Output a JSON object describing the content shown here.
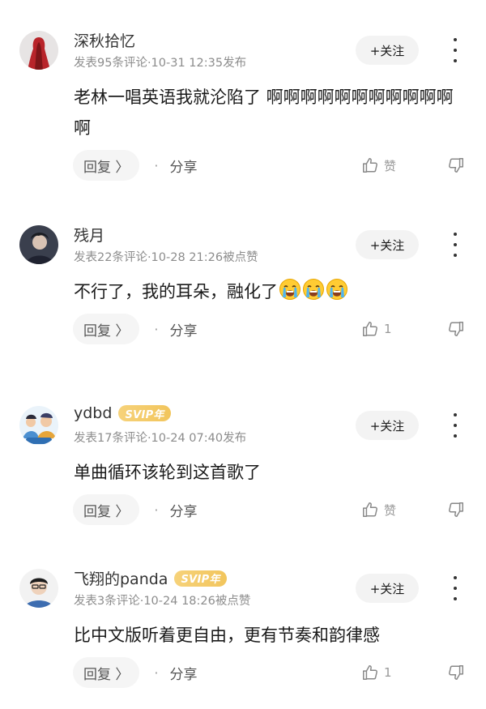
{
  "comments": [
    {
      "username": "深秋拾忆",
      "svip": "",
      "meta": "发表95条评论·10-31 12:35发布",
      "follow": "+关注",
      "text": "老林一唱英语我就沦陷了 啊啊啊啊啊啊啊啊啊啊啊啊",
      "emoji_count": 0,
      "reply": "回复 〉",
      "share": "分享",
      "like": "赞"
    },
    {
      "username": "残月",
      "svip": "",
      "meta": "发表22条评论·10-28 21:26被点赞",
      "follow": "+关注",
      "text": "不行了，我的耳朵，融化了",
      "emoji_count": 3,
      "emoji": "loudly-crying-face",
      "reply": "回复 〉",
      "share": "分享",
      "like": "1"
    },
    {
      "username": "ydbd",
      "svip": "SVIP年",
      "meta": "发表17条评论·10-24 07:40发布",
      "follow": "+关注",
      "text": "单曲循环该轮到这首歌了",
      "emoji_count": 0,
      "reply": "回复 〉",
      "share": "分享",
      "like": "赞"
    },
    {
      "username": "飞翔的panda",
      "svip": "SVIP年",
      "meta": "发表3条评论·10-24 18:26被点赞",
      "follow": "+关注",
      "text": "比中文版听着更自由，更有节奏和韵律感",
      "emoji_count": 0,
      "reply": "回复 〉",
      "share": "分享",
      "like": "1"
    }
  ]
}
